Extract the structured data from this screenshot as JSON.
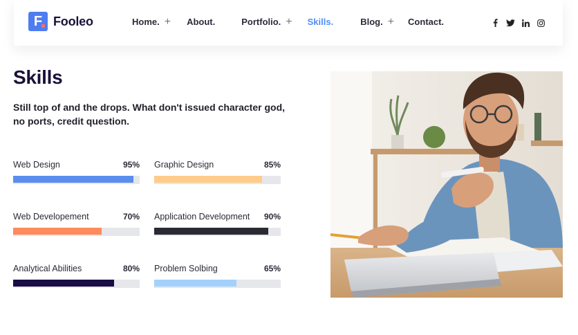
{
  "brand": {
    "mark": "F",
    "name": "Fooleo",
    "accent": "#4f7cf0",
    "dot_color": "#ff6f5e"
  },
  "nav": {
    "items": [
      {
        "label": "Home.",
        "has_submenu": true,
        "active": false
      },
      {
        "label": "About.",
        "has_submenu": false,
        "active": false
      },
      {
        "label": "Portfolio.",
        "has_submenu": true,
        "active": false
      },
      {
        "label": "Skills.",
        "has_submenu": false,
        "active": true
      },
      {
        "label": "Blog.",
        "has_submenu": true,
        "active": false
      },
      {
        "label": "Contact.",
        "has_submenu": false,
        "active": false
      }
    ],
    "submenu_symbol": "+",
    "active_color": "#4f8ef7",
    "social_icons": [
      "facebook-icon",
      "twitter-icon",
      "linkedin-icon",
      "instagram-icon"
    ]
  },
  "skills": {
    "title": "Skills",
    "description": "Still top of and the drops. What don't issued character god, no ports, credit question.",
    "items": [
      {
        "name": "Web Design",
        "value": "95",
        "unit": "%",
        "percent": 95,
        "color": "#5b8def"
      },
      {
        "name": "Graphic Design",
        "value": "85",
        "unit": "%",
        "percent": 85,
        "color": "#ffcc8a"
      },
      {
        "name": "Web Developement",
        "value": "70",
        "unit": "%",
        "percent": 70,
        "color": "#ff8a5c"
      },
      {
        "name": "Application Development",
        "value": "90",
        "unit": "%",
        "percent": 90,
        "color": "#2a2a32"
      },
      {
        "name": "Analytical Abilities",
        "value": "80",
        "unit": "%",
        "percent": 80,
        "color": "#1a0c45"
      },
      {
        "name": "Problem Solbing",
        "value": "65",
        "unit": "%",
        "percent": 65,
        "color": "#a4d1fb"
      }
    ]
  }
}
